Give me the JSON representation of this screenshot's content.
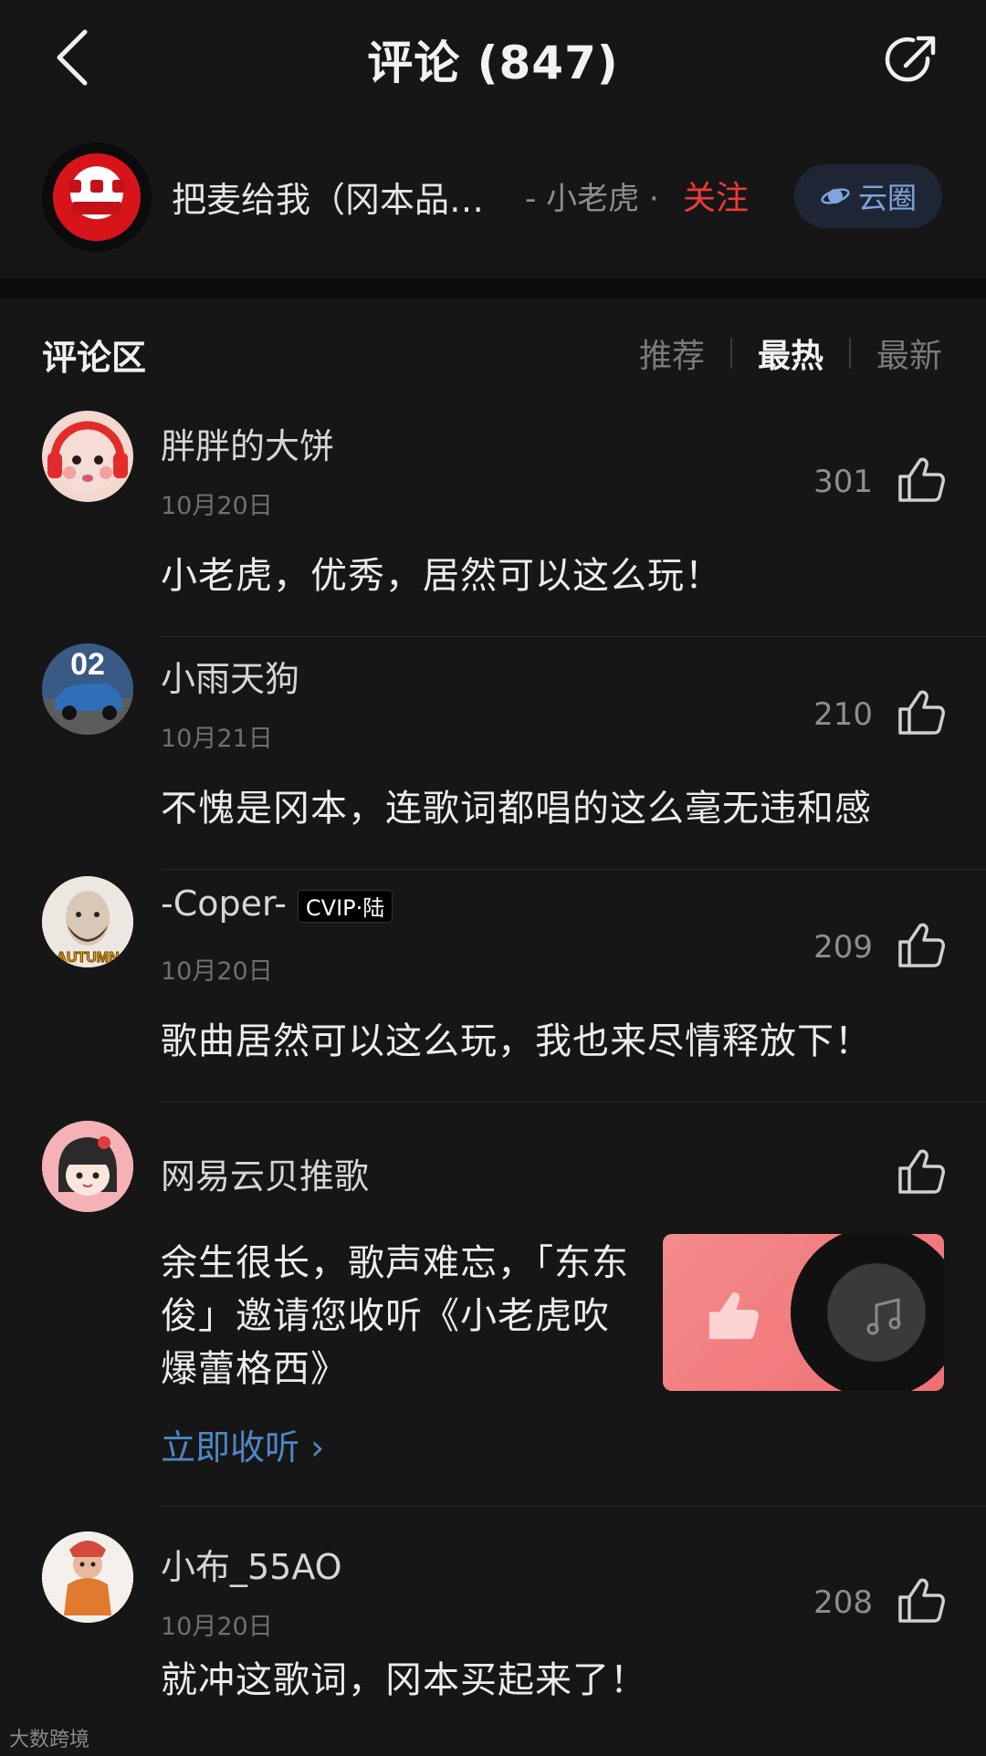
{
  "header": {
    "title": "评论 (847)"
  },
  "song": {
    "cover_text": "把麦给我",
    "name": "把麦给我（冈本品…",
    "artist": "- 小老虎 ·",
    "follow_label": "关注",
    "cloud_label": "云圈"
  },
  "comments_section": {
    "title": "评论区",
    "sort_tabs": [
      "推荐",
      "最热",
      "最新"
    ],
    "active_tab": "最热"
  },
  "comments": [
    {
      "user": "胖胖的大饼",
      "date": "10月20日",
      "likes": "301",
      "text": "小老虎，优秀，居然可以这么玩！"
    },
    {
      "user": "小雨天狗",
      "date": "10月21日",
      "likes": "210",
      "text": "不愧是冈本，连歌词都唱的这么毫无违和感"
    },
    {
      "user": "-Coper-",
      "badge": "CVIP·陆",
      "date": "10月20日",
      "likes": "209",
      "text": "歌曲居然可以这么玩，我也来尽情释放下！"
    },
    {
      "user": "小布_55AO",
      "date": "10月20日",
      "likes": "208",
      "text": "就冲这歌词，冈本买起来了！"
    }
  ],
  "promo": {
    "user": "网易云贝推歌",
    "text": "余生很长，歌声难忘，「东东俊」邀请您收听《小老虎吹爆蕾格西》",
    "link_label": "立即收听 ›"
  },
  "avatar_labels": {
    "xiaoyu": "02",
    "coper": "AUTUMN"
  },
  "watermark": "大数跨境",
  "colors": {
    "background": "#161616",
    "accent_red": "#f03a3a",
    "link_blue": "#4f86c6",
    "cloud_bg": "#1e2636"
  }
}
